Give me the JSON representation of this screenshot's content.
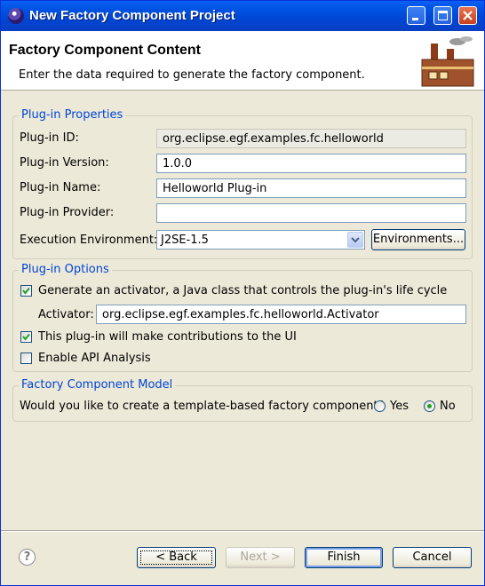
{
  "window": {
    "title": "New Factory Component Project"
  },
  "banner": {
    "title": "Factory Component Content",
    "description": "Enter the data required to generate the factory component."
  },
  "properties": {
    "legend": "Plug-in Properties",
    "id_label": "Plug-in ID:",
    "id_value": "org.eclipse.egf.examples.fc.helloworld",
    "version_label": "Plug-in Version:",
    "version_value": "1.0.0",
    "name_label": "Plug-in Name:",
    "name_value": "Helloworld Plug-in",
    "provider_label": "Plug-in Provider:",
    "provider_value": "",
    "env_label": "Execution Environment:",
    "env_value": "J2SE-1.5",
    "env_button": "Environments..."
  },
  "options": {
    "legend": "Plug-in Options",
    "activator_check_label": "Generate an activator, a Java class that controls the plug-in's life cycle",
    "activator_checked": true,
    "activator_label": "Activator:",
    "activator_value": "org.eclipse.egf.examples.fc.helloworld.Activator",
    "ui_check_label": "This plug-in will make contributions to the UI",
    "ui_checked": true,
    "api_check_label": "Enable API Analysis",
    "api_checked": false
  },
  "model": {
    "legend": "Factory Component Model",
    "question": "Would  you like to create a template-based factory component?",
    "yes_label": "Yes",
    "no_label": "No",
    "selected": "No"
  },
  "footer": {
    "help": "?",
    "back": "< Back",
    "next": "Next >",
    "finish": "Finish",
    "cancel": "Cancel"
  },
  "icons": {
    "app": "eclipse-icon",
    "banner": "factory-icon",
    "help": "help-icon"
  },
  "colors": {
    "title_bar": "#0054e3",
    "group_legend": "#0046d5",
    "dialog_bg": "#ece9d8"
  }
}
